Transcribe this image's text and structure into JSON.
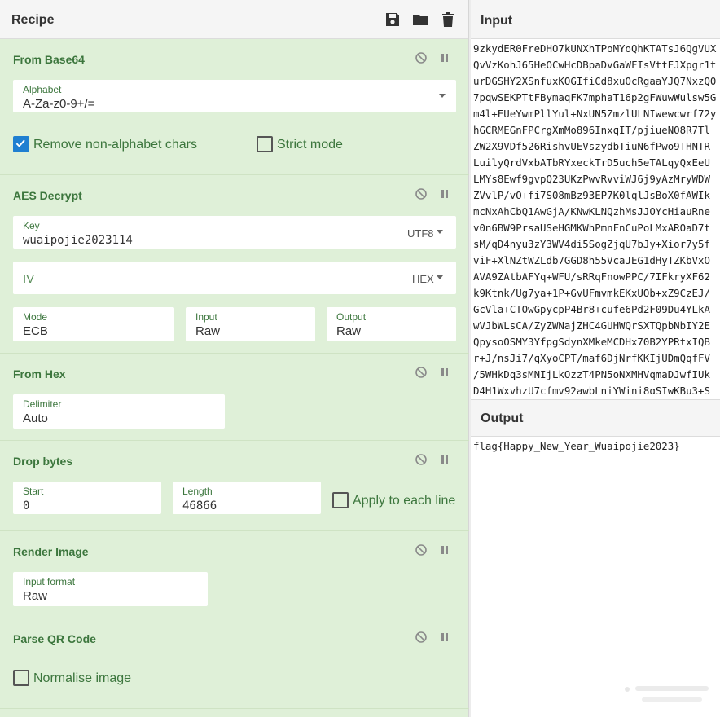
{
  "recipe": {
    "title": "Recipe",
    "icons": [
      "save-icon",
      "folder-icon",
      "trash-icon"
    ]
  },
  "operations": {
    "from_base64": {
      "title": "From Base64",
      "alphabet": {
        "label": "Alphabet",
        "value": "A-Za-z0-9+/="
      },
      "remove_non_alphabet": {
        "label": "Remove non-alphabet chars",
        "checked": true
      },
      "strict_mode": {
        "label": "Strict mode",
        "checked": false
      }
    },
    "aes_decrypt": {
      "title": "AES Decrypt",
      "key": {
        "label": "Key",
        "value": "wuaipojie2023114",
        "encoding": "UTF8"
      },
      "iv": {
        "placeholder": "IV",
        "encoding": "HEX"
      },
      "mode": {
        "label": "Mode",
        "value": "ECB"
      },
      "input": {
        "label": "Input",
        "value": "Raw"
      },
      "output": {
        "label": "Output",
        "value": "Raw"
      }
    },
    "from_hex": {
      "title": "From Hex",
      "delimiter": {
        "label": "Delimiter",
        "value": "Auto"
      }
    },
    "drop_bytes": {
      "title": "Drop bytes",
      "start": {
        "label": "Start",
        "value": "0"
      },
      "length": {
        "label": "Length",
        "value": "46866"
      },
      "apply_each_line": {
        "label": "Apply to each line",
        "checked": false
      }
    },
    "render_image": {
      "title": "Render Image",
      "input_format": {
        "label": "Input format",
        "value": "Raw"
      }
    },
    "parse_qr": {
      "title": "Parse QR Code",
      "normalise": {
        "label": "Normalise image",
        "checked": false
      }
    }
  },
  "input": {
    "title": "Input",
    "lines": [
      "9zkydER0FreDHO7kUNXhTPoMYoQhKTATsJ6QgVUX",
      "QvVzKohJ65HeOCwHcDBpaDvGaWFIsVttEJXpgr1t",
      "urDGSHY2XSnfuxKOGIfiCd8xuOcRgaaYJQ7NxzQ0",
      "7pqwSEKPTtFBymaqFK7mphaT16p2gFWuwWulsw5G",
      "m4l+EUeYwmPllYul+NxUN5ZmzlULNIwewcwrf72y",
      "hGCRMEGnFPCrgXmMo896InxqIT/pjiueNO8R7Tl",
      "ZW2X9VDf526RishvUEVszydbTiuN6fPwo9THNTR",
      "LuilyQrdVxbATbRYxeckTrD5uch5eTALqyQxEeU",
      "LMYs8Ewf9gvpQ23UKzPwvRvviWJ6j9yAzMryWDW",
      "ZVvlP/vO+fi7S08mBz93EP7K0lqlJsBoX0fAWIk",
      "mcNxAhCbQ1AwGjA/KNwKLNQzhMsJJOYcHiauRne",
      "v0n6BW9PrsaUSeHGMKWhPmnFnCuPoLMxAROaD7t",
      "sM/qD4nyu3zY3WV4di5SogZjqU7bJy+Xior7y5f",
      "viF+XlNZtWZLdb7GGD8h55VcaJEG1dHyTZKbVxO",
      "AVA9ZAtbAFYq+WFU/sRRqFnowPPC/7IFkryXF62",
      "k9Ktnk/Ug7ya+1P+GvUFmvmkEKxUOb+xZ9CzEJ/",
      "GcVla+CTOwGpycpP4Br8+cufe6Pd2F09Du4YLkA",
      "wVJbWLsCA/ZyZWNajZHC4GUHWQrSXTQpbNbIY2E",
      "QpysoOSMY3YfpgSdynXMkeMCDHx70B2YPRtxIQB",
      "r+J/nsJi7/qXyoCPT/maf6DjNrfKKIjUDmQqfFV",
      "/5WHkDq3sMNIjLkOzzT4PN5oNXMHVqmaDJwfIUk",
      "D4H1WxvhzU7cfmv92awbLniYWini8qSIwKBu3+S"
    ]
  },
  "output": {
    "title": "Output",
    "text": "flag{Happy_New_Year_Wuaipojie2023}"
  },
  "colors": {
    "recipe_bg": "#dff0d8",
    "label_green": "#3c763d",
    "checkbox_blue": "#1f7fd1"
  }
}
